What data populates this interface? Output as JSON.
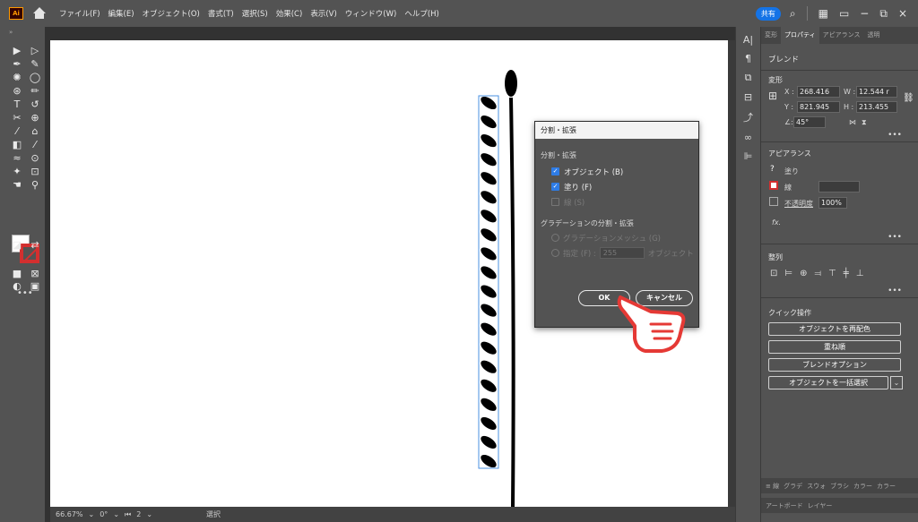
{
  "menubar": {
    "logo": "Ai",
    "items": [
      "ファイル(F)",
      "編集(E)",
      "オブジェクト(O)",
      "書式(T)",
      "選択(S)",
      "効果(C)",
      "表示(V)",
      "ウィンドウ(W)",
      "ヘルプ(H)"
    ],
    "share_label": "共有",
    "window_controls": [
      "−",
      "⧉",
      "×"
    ]
  },
  "status": {
    "zoom": "66.67%",
    "rotation": "0°",
    "artboard": "2",
    "tool": "選択"
  },
  "dialog": {
    "title": "分割・拡張",
    "section1": "分割・拡張",
    "object_label": "オブジェクト (B)",
    "fill_label": "塗り (F)",
    "stroke_label": "線 (S)",
    "section2": "グラデーションの分割・拡張",
    "gradient_mesh_label": "グラデーションメッシュ (G)",
    "specify_label": "指定 (F) :",
    "specify_value": "255",
    "specify_unit": "オブジェクト",
    "ok_label": "OK",
    "cancel_label": "キャンセル"
  },
  "panel": {
    "tabs": [
      "変形",
      "プロパティ",
      "アピアランス",
      "透明"
    ],
    "active_tab": "プロパティ",
    "object_type": "ブレンド",
    "transform": {
      "title": "変形",
      "x_label": "X :",
      "x": "268.416",
      "y_label": "Y :",
      "y": "821.945",
      "w_label": "W :",
      "w": "12.544 r",
      "h_label": "H :",
      "h": "213.455",
      "angle": "45°"
    },
    "appearance": {
      "title": "アピアランス",
      "fill": "塗り",
      "stroke": "線",
      "opacity_label": "不透明度",
      "opacity": "100%",
      "fx": "fx."
    },
    "align_title": "整列",
    "quick_title": "クイック操作",
    "quick_actions": [
      "オブジェクトを再配色",
      "重ね順",
      "ブレンドオプション",
      "オブジェクトを一括選択"
    ],
    "bottom_tabs_1": [
      "≡ 線",
      "グラデ",
      "スウォ",
      "ブラシ",
      "カラー",
      "カラー"
    ],
    "bottom_tabs_2": [
      "アートボード",
      "レイヤー"
    ]
  },
  "colors": {
    "accent": "#1473e6",
    "stroke_red": "#d32f2f",
    "hand_outline": "#e53935",
    "panel_bg": "#535353"
  }
}
